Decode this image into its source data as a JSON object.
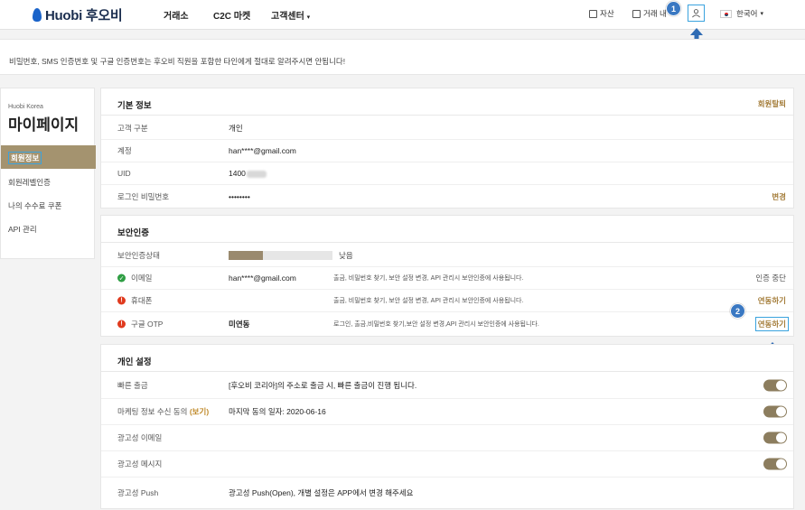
{
  "header": {
    "logo": "Huobi 후오비",
    "nav": [
      "거래소",
      "C2C 마켓",
      "고객센터"
    ],
    "right": {
      "assets": "자산",
      "orders": "거래 내",
      "language": "한국어"
    },
    "annotations": {
      "step1": "1",
      "step2": "2"
    }
  },
  "notice": "비밀번호, SMS 인증번호 및 구글 인증번호는 후오비 직원을 포함한 타인에게 절대로 알려주시면 안됩니다!",
  "sidebar": {
    "subtitle": "Huobi Korea",
    "title": "마이페이지",
    "items": [
      "회원정보",
      "회원레벨인증",
      "나의 수수료 쿠폰",
      "API 관리"
    ]
  },
  "basic": {
    "title": "기본 정보",
    "action": "회원탈퇴",
    "rows": [
      {
        "label": "고객 구분",
        "value": "개인"
      },
      {
        "label": "계정",
        "value": "han****@gmail.com"
      },
      {
        "label": "UID",
        "value": "1400"
      },
      {
        "label": "로그인 비밀번호",
        "value": "••••••••",
        "action": "변경"
      }
    ]
  },
  "security": {
    "title": "보안인증",
    "level_label": "보안인증상태",
    "level_text": "낮음",
    "level_fraction": 0.33,
    "rows": [
      {
        "label": "이메일",
        "status": "ok",
        "value": "han****@gmail.com",
        "desc": "출금, 비밀번호 찾기, 보안 설정 변경, API 관리시 보안인증에 사용됩니다.",
        "action": "인증 중단"
      },
      {
        "label": "휴대폰",
        "status": "warn",
        "value": "",
        "desc": "출금, 비밀번호 찾기, 보안 설정 변경, API 관리시 보안인증에 사용됩니다.",
        "action": "연동하기"
      },
      {
        "label": "구글 OTP",
        "status": "warn",
        "value": "미연동",
        "desc": "로그인, 출금,비밀번호 찾기,보안 설정 변경,API 관리시 보안인증에 사용됩니다.",
        "action": "연동하기"
      }
    ]
  },
  "personal": {
    "title": "개인 설정",
    "rows": [
      {
        "label": "빠른 출금",
        "value": "[후오비 코리아]의 주소로 출금 시, 빠른 출금이 진행 됩니다.",
        "toggle": true
      },
      {
        "label": "마케팅 정보 수신 동의",
        "link": "(보기)",
        "value": "마지막 동의 일자: 2020-06-16",
        "toggle": true
      },
      {
        "label": "광고성 이메일",
        "value": "",
        "toggle": true
      },
      {
        "label": "광고성 메시지",
        "value": "",
        "toggle": true
      },
      {
        "label": "광고성 Push",
        "value": "광고성 Push(Open), 개별 설정은 APP에서 변경 해주세요",
        "toggle": false
      }
    ]
  },
  "colors": {
    "accent": "#a4936f",
    "link": "#a47d3a",
    "highlight": "#3aa3de",
    "badge": "#3a78c2"
  }
}
